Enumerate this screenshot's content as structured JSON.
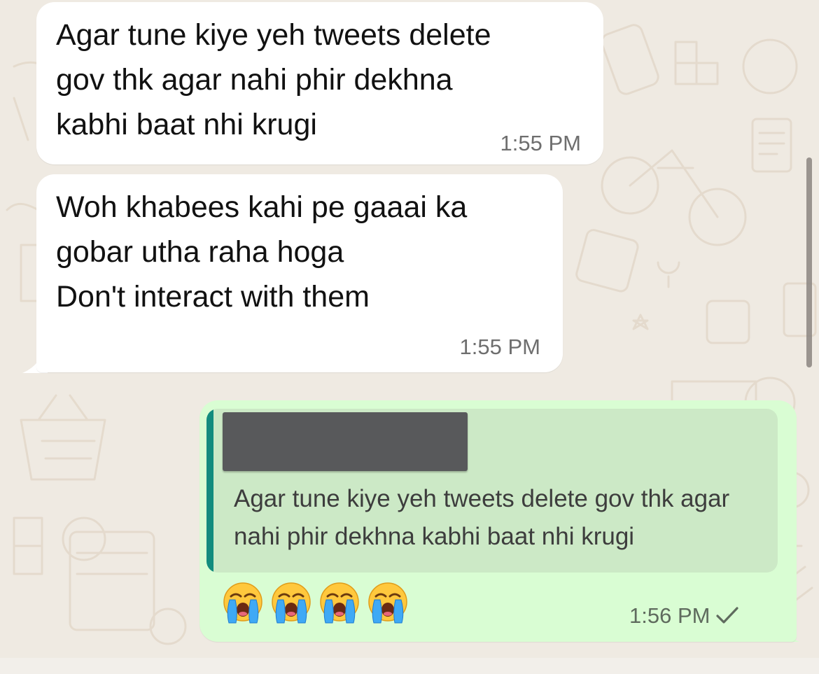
{
  "chat": {
    "messages": [
      {
        "direction": "incoming",
        "text": "Agar tune kiye yeh tweets delete\ngov thk agar nahi phir dekhna\nkabhi baat nhi krugi",
        "time": "1:55 PM"
      },
      {
        "direction": "incoming",
        "text": "Woh khabees kahi pe gaaai ka\ngobar utha raha hoga\nDon't interact with them",
        "time": "1:55 PM"
      },
      {
        "direction": "outgoing",
        "reply_to": {
          "sender_redacted": true,
          "text": "Agar tune kiye yeh tweets delete gov thk agar nahi phir dekhna kabhi baat nhi krugi"
        },
        "emojis": [
          "loudly-crying-face",
          "loudly-crying-face",
          "loudly-crying-face",
          "loudly-crying-face"
        ],
        "time": "1:56 PM",
        "status_icon": "single-check-icon"
      }
    ]
  },
  "colors": {
    "wallpaper": "#EFEAE2",
    "incoming_bubble": "#FFFFFF",
    "outgoing_bubble": "#D9FDD3",
    "quote_background": "#CCE9C6",
    "quote_accent": "#128C7E"
  }
}
